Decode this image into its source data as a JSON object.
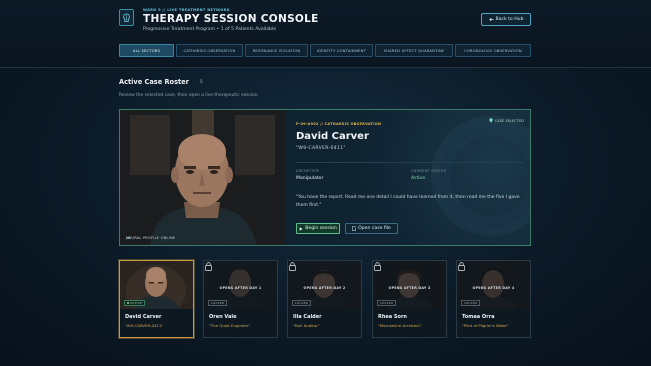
{
  "header": {
    "eyebrow": "WARD 9 // LIVE TREATMENT NETWORK",
    "title": "THERAPY SESSION CONSOLE",
    "subtitle": "Progressive Treatment Program • 1 of 5 Patients Available",
    "back_label": "Back to Hub",
    "logo_icon": "brain-icon"
  },
  "tabs": [
    {
      "label": "ALL SECTORS",
      "active": true
    },
    {
      "label": "CATHARSIS OBSERVATION",
      "active": false
    },
    {
      "label": "RESONANCE ISOLATION",
      "active": false
    },
    {
      "label": "IDENTITY CONTAINMENT",
      "active": false
    },
    {
      "label": "SHARED AFFECT QUARANTINE",
      "active": false
    },
    {
      "label": "CHRONOLOGY OBSERVATION",
      "active": false
    }
  ],
  "roster_section": {
    "title": "Active Case Roster",
    "count": "5",
    "description": "Review the selected case, then open a live therapeutic session."
  },
  "featured": {
    "case_tag": "P-09-A902 // CATHARSIS OBSERVATION",
    "selected_label": "CASE SELECTED",
    "name": "David Carver",
    "alias": "\"W9-CARVER-0411\"",
    "archetype_label": "ARCHETYPE",
    "archetype_value": "Manipulator",
    "status_label": "CURRENT STATUS",
    "status_value": "Active",
    "quote": "\"You have the report. Read me one detail I could have learned from it, then read me the five I gave them first.\"",
    "neural_label": "NEURAL PROFILE ONLINE",
    "begin_label": "Begin session",
    "open_file_label": "Open case file",
    "colors": {
      "accent_gold": "#e0b34c",
      "active_green": "#7fe0a8",
      "archetype": "#e8eef2"
    }
  },
  "roster": [
    {
      "name": "David Carver",
      "alias": "\"W9-CARVER-0411\"",
      "status": "ACTIVE",
      "locked": false,
      "lock_text": "",
      "selected": true
    },
    {
      "name": "Oren Vale",
      "alias": "\"The Quiet Engineer\"",
      "status": "LOCKED",
      "locked": true,
      "lock_text": "OPENS AFTER DAY 1",
      "selected": false
    },
    {
      "name": "Ilia Calder",
      "alias": "\"Null Auditor\"",
      "status": "LOCKED",
      "locked": true,
      "lock_text": "OPENS AFTER DAY 2",
      "selected": false
    },
    {
      "name": "Rhea Sorn",
      "alias": "\"Morrowline Architect\"",
      "status": "LOCKED",
      "locked": true,
      "lock_text": "OPENS AFTER DAY 3",
      "selected": false
    },
    {
      "name": "Tomaa Orra",
      "alias": "\"Pilot of Pilgrim's Wake\"",
      "status": "LOCKED",
      "locked": true,
      "lock_text": "OPENS AFTER DAY 4",
      "selected": false
    }
  ]
}
